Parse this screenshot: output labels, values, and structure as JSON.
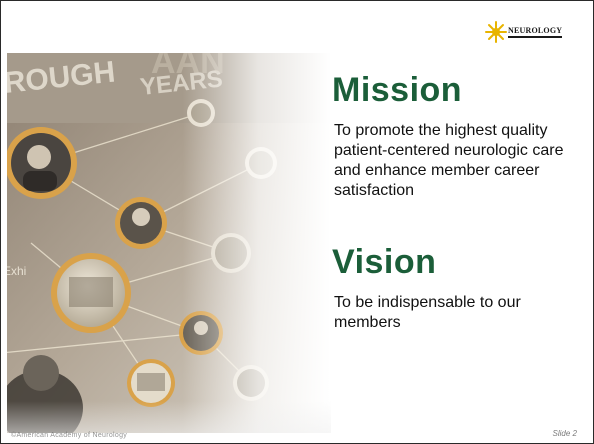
{
  "logo": {
    "wordmark": "NEUROLOGY",
    "accent_color": "#e8b400"
  },
  "mission": {
    "heading": "Mission",
    "text": "To promote the highest quality patient-centered neurologic care and enhance member career satisfaction"
  },
  "vision": {
    "heading": "Vision",
    "text": "To be indispensable to our members"
  },
  "photo": {
    "wall_text_top": "ROUGH",
    "wall_text_top2": "YEARS",
    "wall_text_mid": "Exhi"
  },
  "footer": {
    "left": "©American Academy of Neurology",
    "slide_label": "Slide 2"
  },
  "colors": {
    "heading_green": "#1b5e39",
    "frame_dark": "#2a2a2a"
  }
}
